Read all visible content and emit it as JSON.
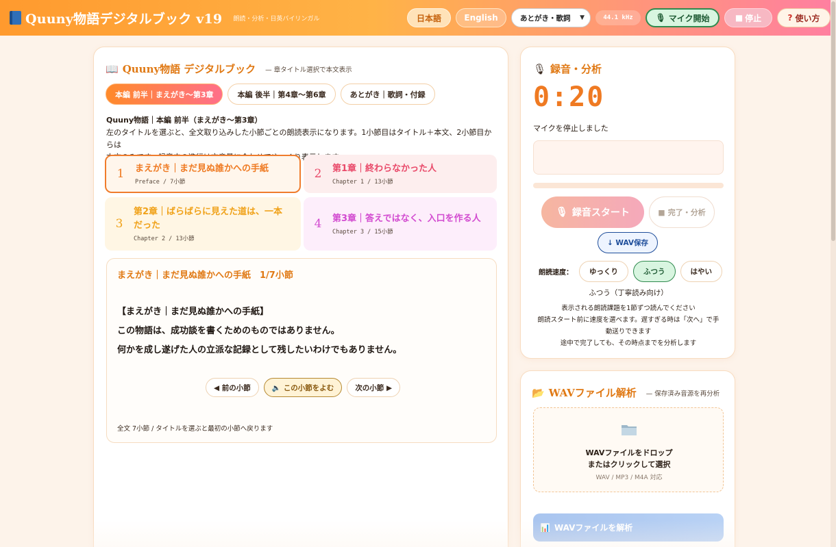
{
  "header": {
    "title": "Quuny物語デジタルブック v19",
    "subtitle": "朗読・分析・日英バイリンガル",
    "lang_ja": "日本語",
    "lang_en": "English",
    "section_select": "あとがき・歌詞",
    "sample_rate": "44.1 kHz",
    "mic_start": "マイク開始",
    "stop": "停止",
    "help": "使い方"
  },
  "book": {
    "title": "Quuny物語 デジタルブック",
    "note": "— 章タイトル選択で本文表示",
    "tabs": [
      {
        "label": "本編 前半｜まえがき〜第3章",
        "active": true
      },
      {
        "label": "本編 後半｜第4章〜第6章",
        "active": false
      },
      {
        "label": "あとがき｜歌詞・付録",
        "active": false
      }
    ],
    "desc_title": "Quuny物語｜本編 前半（まえがき〜第3章）",
    "desc_line1": "左のタイトルを選ぶと、全文取り込みした小節ごとの朗読表示になります。1小節目はタイトル＋本文、2小節目からは",
    "desc_line2": "本文のみです。録音中の進行は文章量に合わせてゆっくり表示します。",
    "chapters": [
      {
        "num": "1",
        "title": "まえがき｜まだ見ぬ誰かへの手紙",
        "sub": "Preface / 7小節"
      },
      {
        "num": "2",
        "title": "第1章｜終わらなかった人",
        "sub": "Chapter 1 / 13小節"
      },
      {
        "num": "3",
        "title": "第2章｜ばらばらに見えた道は、一本だった",
        "sub": "Chapter 2 / 13小節"
      },
      {
        "num": "4",
        "title": "第3章｜答えではなく、入口を作る人",
        "sub": "Chapter 3 / 15小節"
      }
    ],
    "reader": {
      "heading": "まえがき｜まだ見ぬ誰かへの手紙　1/7小節",
      "lines": [
        "【まえがき｜まだ見ぬ誰かへの手紙】",
        "この物語は、成功談を書くためのものではありません。",
        "何かを成し遂げた人の立派な記録として残したいわけでもありません。"
      ],
      "prev": "◀ 前の小節",
      "read": "この小節をよむ",
      "next": "次の小節 ▶",
      "footer": "全文 7小節 / タイトルを選ぶと最初の小節へ戻ります"
    }
  },
  "recorder": {
    "title": "録音・分析",
    "timer": "0:20",
    "status": "マイクを停止しました",
    "progress": 0,
    "start": "録音スタート",
    "finish": "完了・分析",
    "wav_save": "↓ WAV保存",
    "speed_label": "朗読速度：",
    "speeds": [
      {
        "label": "ゆっくり",
        "active": false
      },
      {
        "label": "ふつう",
        "active": true
      },
      {
        "label": "はやい",
        "active": false
      }
    ],
    "speed_note": "ふつう（丁寧読み向け）",
    "help_1": "表示される朗読課題を1節ずつ読んでください",
    "help_2": "朗読スタート前に速度を選べます。遅すぎる時は「次へ」で手",
    "help_3": "動送りできます",
    "help_4": "途中で完了しても、その時点までを分析します"
  },
  "wav": {
    "title": "WAVファイル解析",
    "note": "— 保存済み音源を再分析",
    "drop_1": "WAVファイルをドロップ",
    "drop_2": "またはクリックして選択",
    "formats": "WAV / MP3 / M4A 対応",
    "analyze": "WAVファイルを解析"
  },
  "colors": {
    "accent": "#ef7a22",
    "pink": "#ff6f8a",
    "green": "#2f8a4e",
    "blue": "#1e4d9a"
  }
}
